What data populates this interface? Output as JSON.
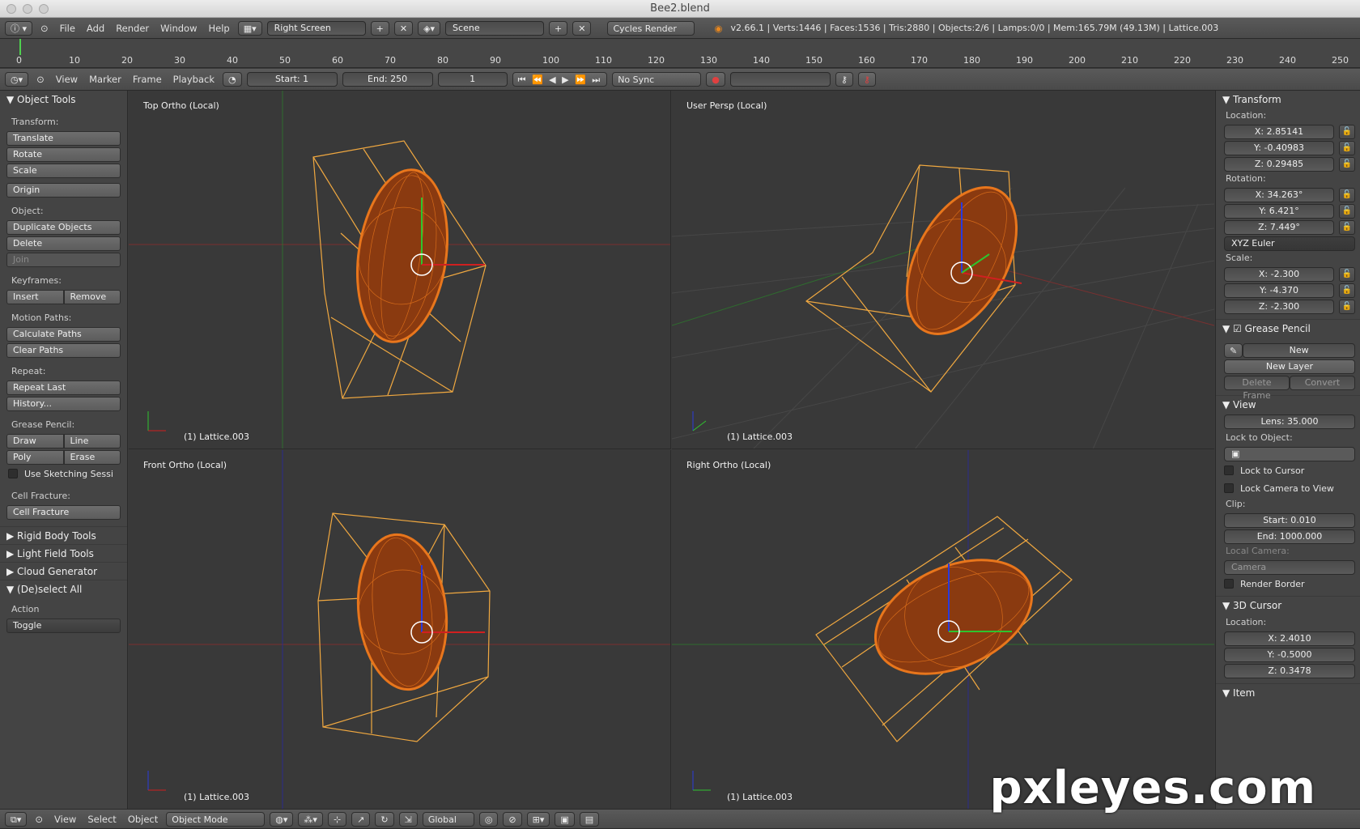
{
  "window": {
    "title": "Bee2.blend"
  },
  "info_header": {
    "menus": [
      "File",
      "Add",
      "Render",
      "Window",
      "Help"
    ],
    "screen": "Right Screen",
    "scene": "Scene",
    "engine": "Cycles Render",
    "stats": "v2.66.1 | Verts:1446 | Faces:1536 | Tris:2880 | Objects:2/6 | Lamps:0/0 | Mem:165.79M (49.13M) | Lattice.003"
  },
  "ruler": {
    "ticks": [
      "0",
      "10",
      "20",
      "30",
      "40",
      "50",
      "60",
      "70",
      "80",
      "90",
      "100",
      "110",
      "120",
      "130",
      "140",
      "150",
      "160",
      "170",
      "180",
      "190",
      "200",
      "210",
      "220",
      "230",
      "240",
      "250"
    ]
  },
  "timeline": {
    "menus": [
      "View",
      "Marker",
      "Frame",
      "Playback"
    ],
    "start": "Start: 1",
    "end": "End: 250",
    "frame": "1",
    "sync": "No Sync"
  },
  "tools": {
    "title": "Object Tools",
    "transform_label": "Transform:",
    "translate": "Translate",
    "rotate": "Rotate",
    "scale": "Scale",
    "origin": "Origin",
    "object_label": "Object:",
    "duplicate": "Duplicate Objects",
    "delete": "Delete",
    "join": "Join",
    "keyframes_label": "Keyframes:",
    "insert": "Insert",
    "remove": "Remove",
    "motion_label": "Motion Paths:",
    "calc_paths": "Calculate Paths",
    "clear_paths": "Clear Paths",
    "repeat_label": "Repeat:",
    "repeat_last": "Repeat Last",
    "history": "History...",
    "grease_label": "Grease Pencil:",
    "draw": "Draw",
    "line": "Line",
    "poly": "Poly",
    "erase": "Erase",
    "sketch": "Use Sketching Sessi",
    "cell_label": "Cell Fracture:",
    "cell_fracture": "Cell Fracture",
    "rigid": "Rigid Body Tools",
    "lightfield": "Light Field Tools",
    "cloud": "Cloud Generator",
    "deselect": "(De)select All",
    "action_label": "Action",
    "toggle": "Toggle"
  },
  "viewports": [
    {
      "label": "Top Ortho (Local)",
      "obj": "(1) Lattice.003"
    },
    {
      "label": "User Persp (Local)",
      "obj": "(1) Lattice.003"
    },
    {
      "label": "Front Ortho (Local)",
      "obj": "(1) Lattice.003"
    },
    {
      "label": "Right Ortho (Local)",
      "obj": "(1) Lattice.003"
    }
  ],
  "props": {
    "transform": "Transform",
    "location_label": "Location:",
    "loc_x": "X: 2.85141",
    "loc_y": "Y: -0.40983",
    "loc_z": "Z: 0.29485",
    "rotation_label": "Rotation:",
    "rot_x": "X: 34.263°",
    "rot_y": "Y: 6.421°",
    "rot_z": "Z: 7.449°",
    "rot_mode": "XYZ Euler",
    "scale_label": "Scale:",
    "sc_x": "X: -2.300",
    "sc_y": "Y: -4.370",
    "sc_z": "Z: -2.300",
    "grease": "Grease Pencil",
    "new": "New",
    "new_layer": "New Layer",
    "delete_frame": "Delete Frame",
    "convert": "Convert",
    "view": "View",
    "lens": "Lens: 35.000",
    "lock_obj": "Lock to Object:",
    "lock_cursor": "Lock to Cursor",
    "lock_cam": "Lock Camera to View",
    "clip": "Clip:",
    "clip_start": "Start: 0.010",
    "clip_end": "End: 1000.000",
    "local_cam": "Local Camera:",
    "camera": "Camera",
    "render_border": "Render Border",
    "cursor": "3D Cursor",
    "cursor_loc": "Location:",
    "cur_x": "X: 2.4010",
    "cur_y": "Y: -0.5000",
    "cur_z": "Z: 0.3478",
    "item": "Item"
  },
  "bottom": {
    "menus": [
      "View",
      "Select",
      "Object"
    ],
    "mode": "Object Mode",
    "orientation": "Global"
  },
  "watermark": "pxleyes.com",
  "colors": {
    "wire": "#e8761c",
    "lattice": "#f0a840",
    "grid": "#444"
  }
}
